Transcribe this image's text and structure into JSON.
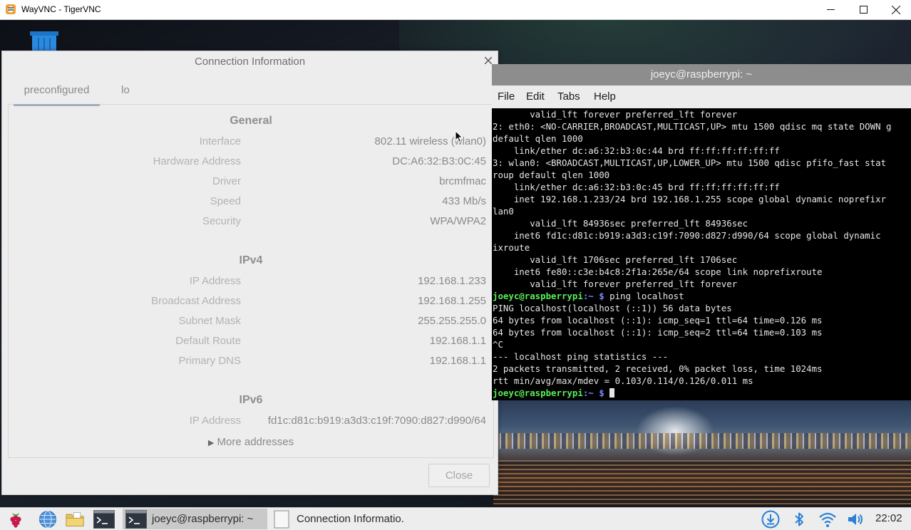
{
  "vnc_window": {
    "title": "WayVNC - TigerVNC"
  },
  "dialog": {
    "title": "Connection Information",
    "tabs": [
      {
        "label": "preconfigured",
        "active": true
      },
      {
        "label": "lo",
        "active": false
      }
    ],
    "general": {
      "heading": "General",
      "rows": [
        {
          "label": "Interface",
          "value": "802.11 wireless (wlan0)"
        },
        {
          "label": "Hardware Address",
          "value": "DC:A6:32:B3:0C:45"
        },
        {
          "label": "Driver",
          "value": "brcmfmac"
        },
        {
          "label": "Speed",
          "value": "433 Mb/s"
        },
        {
          "label": "Security",
          "value": "WPA/WPA2"
        }
      ]
    },
    "ipv4": {
      "heading": "IPv4",
      "rows": [
        {
          "label": "IP Address",
          "value": "192.168.1.233"
        },
        {
          "label": "Broadcast Address",
          "value": "192.168.1.255"
        },
        {
          "label": "Subnet Mask",
          "value": "255.255.255.0"
        },
        {
          "label": "Default Route",
          "value": "192.168.1.1"
        },
        {
          "label": "Primary DNS",
          "value": "192.168.1.1"
        }
      ]
    },
    "ipv6": {
      "heading": "IPv6",
      "rows": [
        {
          "label": "IP Address",
          "value": "fd1c:d81c:b919:a3d3:c19f:7090:d827:d990/64"
        }
      ],
      "more_addresses": "More addresses"
    },
    "close_label": "Close"
  },
  "terminal": {
    "title": "joeyc@raspberrypi: ~",
    "menu": [
      "File",
      "Edit",
      "Tabs",
      "Help"
    ],
    "lines": [
      "       valid_lft forever preferred_lft forever",
      "2: eth0: <NO-CARRIER,BROADCAST,MULTICAST,UP> mtu 1500 qdisc mq state DOWN g",
      "default qlen 1000",
      "    link/ether dc:a6:32:b3:0c:44 brd ff:ff:ff:ff:ff:ff",
      "3: wlan0: <BROADCAST,MULTICAST,UP,LOWER_UP> mtu 1500 qdisc pfifo_fast stat",
      "roup default qlen 1000",
      "    link/ether dc:a6:32:b3:0c:45 brd ff:ff:ff:ff:ff:ff",
      "    inet 192.168.1.233/24 brd 192.168.1.255 scope global dynamic noprefixr",
      "lan0",
      "       valid_lft 84936sec preferred_lft 84936sec",
      "    inet6 fd1c:d81c:b919:a3d3:c19f:7090:d827:d990/64 scope global dynamic",
      "ixroute",
      "       valid_lft 1706sec preferred_lft 1706sec",
      "    inet6 fe80::c3e:b4c8:2f1a:265e/64 scope link noprefixroute",
      "       valid_lft forever preferred_lft forever"
    ],
    "prompt_user": "joeyc@raspberrypi",
    "prompt_path": ":~ $",
    "command": " ping localhost",
    "output": [
      "PING localhost(localhost (::1)) 56 data bytes",
      "64 bytes from localhost (::1): icmp_seq=1 ttl=64 time=0.126 ms",
      "64 bytes from localhost (::1): icmp_seq=2 ttl=64 time=0.103 ms",
      "^C",
      "--- localhost ping statistics ---",
      "2 packets transmitted, 2 received, 0% packet loss, time 1024ms",
      "rtt min/avg/max/mdev = 0.103/0.114/0.126/0.011 ms"
    ]
  },
  "taskbar": {
    "tasks": [
      {
        "label": "joeyc@raspberrypi: ~"
      },
      {
        "label": "Connection Informatio."
      }
    ],
    "clock": "22:02"
  },
  "colors": {
    "prompt_user": "#59ef59",
    "prompt_path": "#7a8dff",
    "terminal_bg": "#000000",
    "dialog_bg": "#ededed"
  }
}
